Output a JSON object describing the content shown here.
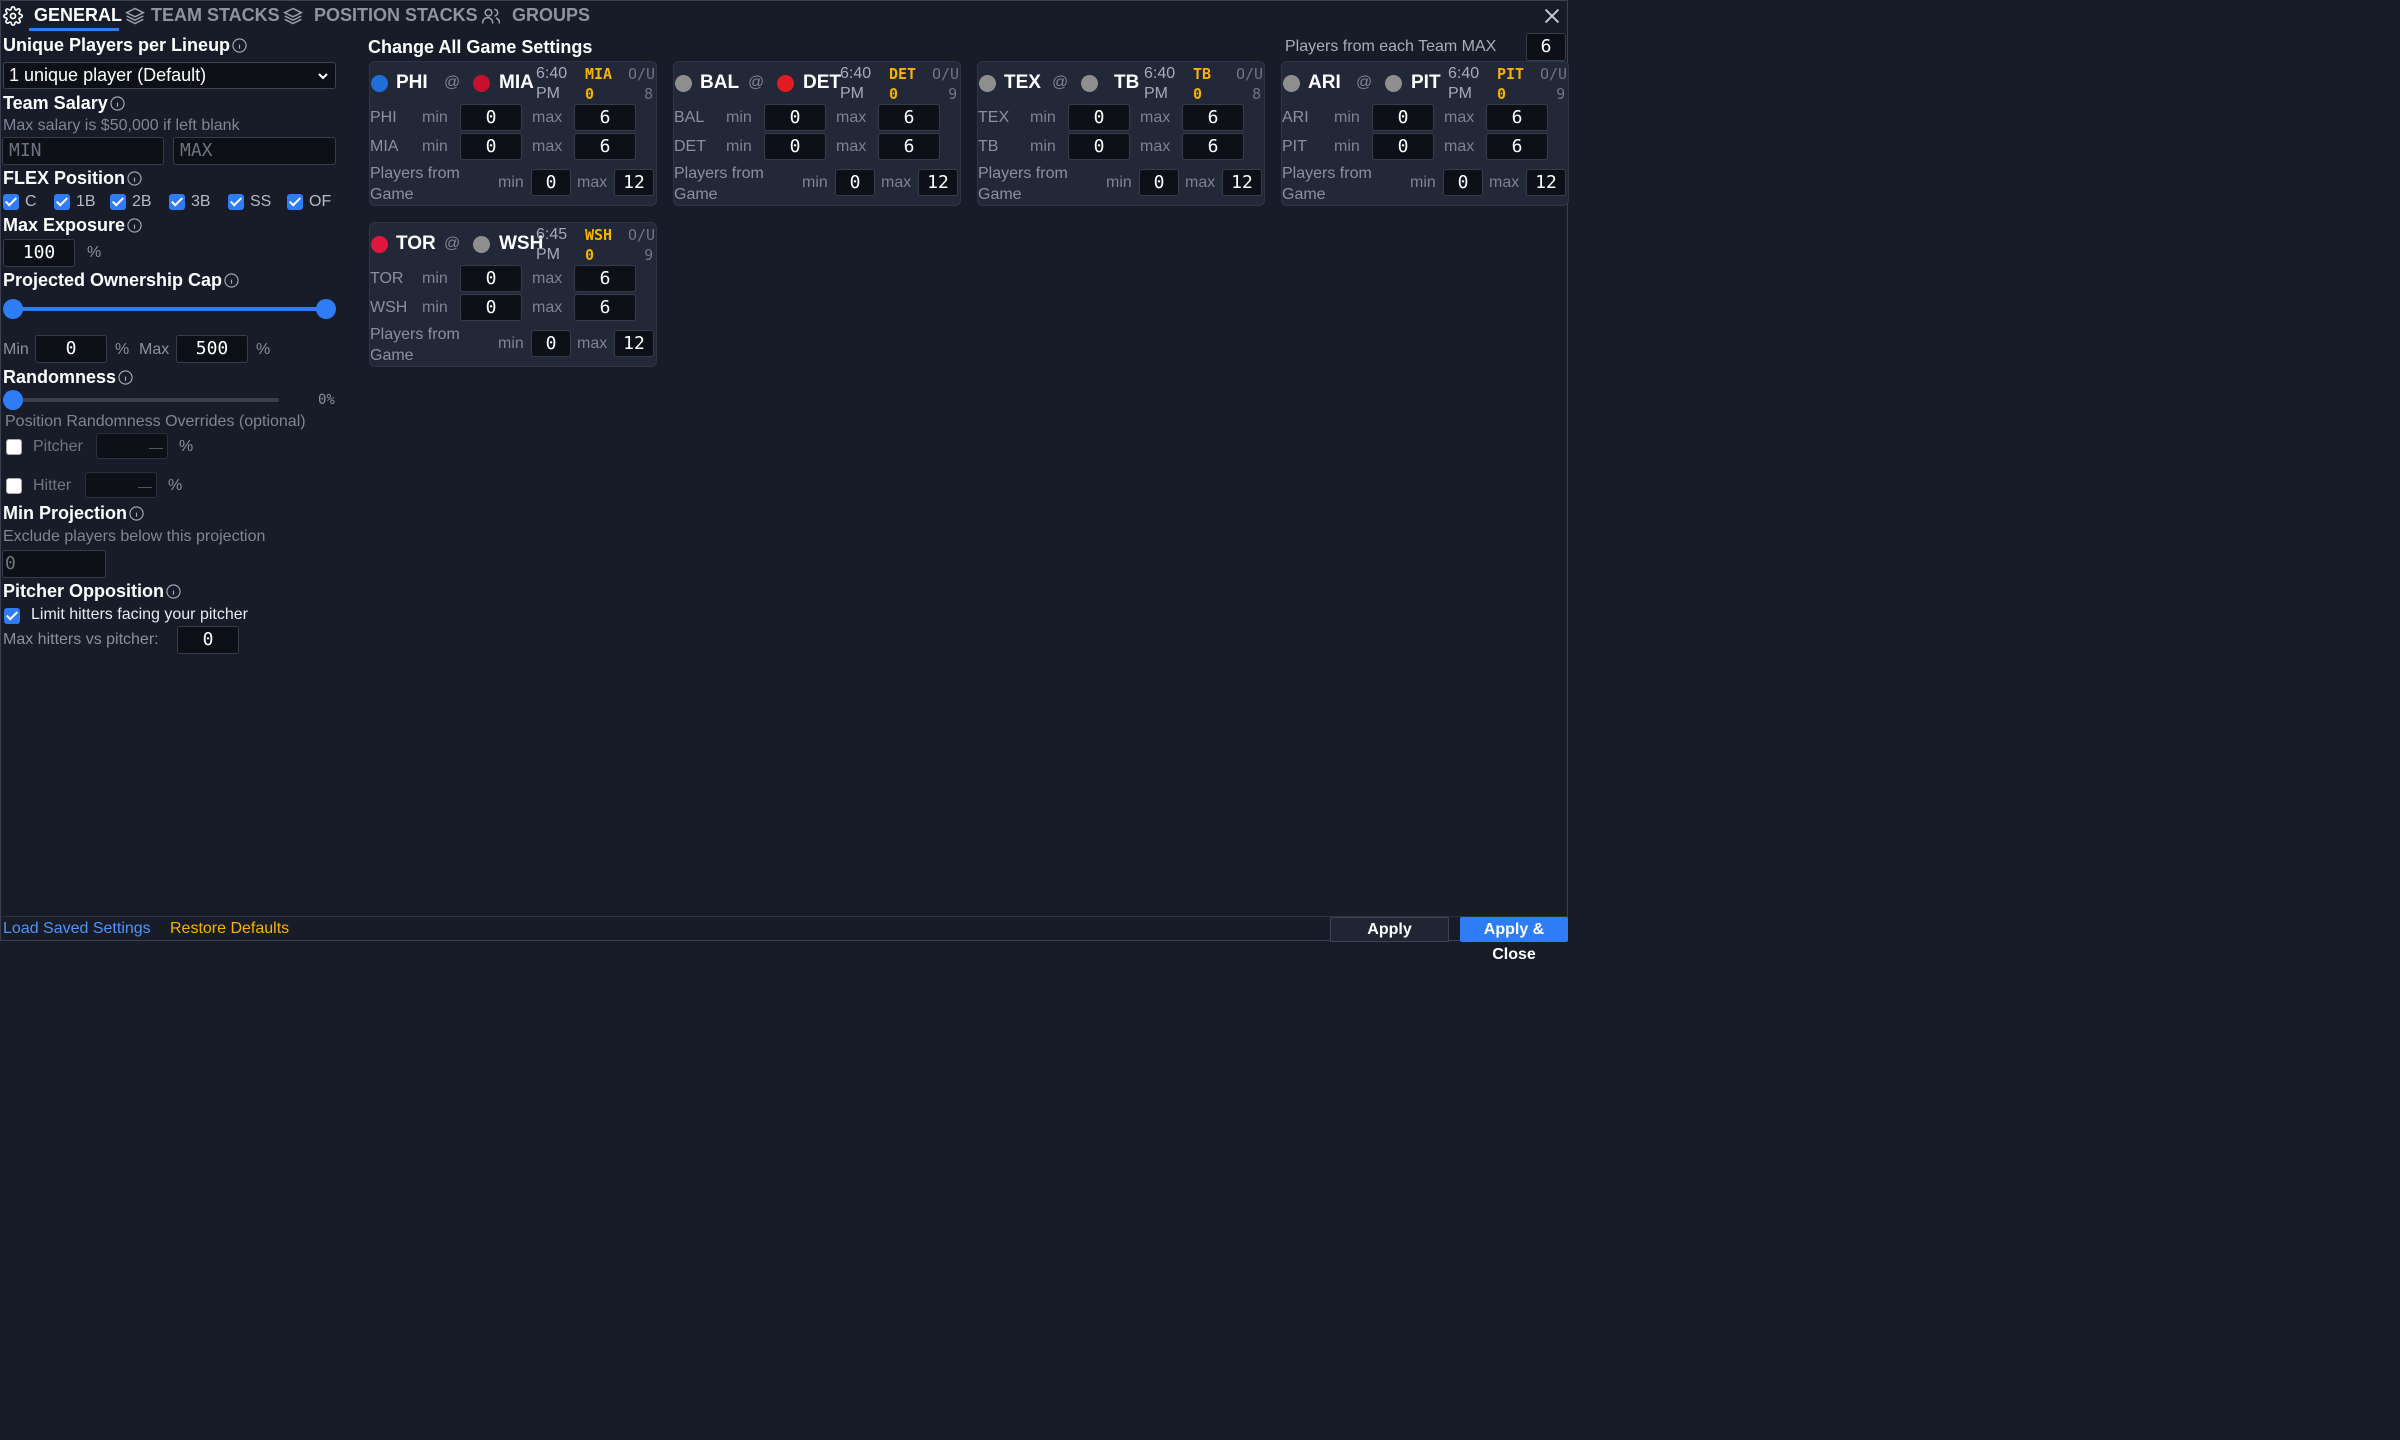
{
  "tabs": [
    {
      "label": "GENERAL"
    },
    {
      "label": "TEAM STACKS"
    },
    {
      "label": "POSITION STACKS"
    },
    {
      "label": "GROUPS"
    }
  ],
  "general": {
    "unique_players": {
      "title": "Unique Players per Lineup",
      "selected": "1 unique player (Default)"
    },
    "team_salary": {
      "title": "Team Salary",
      "hint": "Max salary is $50,000 if left blank",
      "min_placeholder": "MIN",
      "max_placeholder": "MAX"
    },
    "flex_position": {
      "title": "FLEX Position",
      "options": [
        "C",
        "1B",
        "2B",
        "3B",
        "SS",
        "OF"
      ]
    },
    "max_exposure": {
      "title": "Max Exposure",
      "value": "100",
      "unit": "%"
    },
    "ownership_cap": {
      "title": "Projected Ownership Cap",
      "min_label": "Min",
      "min_value": "0",
      "max_label": "Max",
      "max_value": "500",
      "unit": "%"
    },
    "randomness": {
      "title": "Randomness",
      "value_label": "0%",
      "overrides_hint": "Position Randomness Overrides (optional)",
      "pitcher_label": "Pitcher",
      "hitter_label": "Hitter",
      "unit": "%",
      "dash": "—"
    },
    "min_projection": {
      "title": "Min Projection",
      "hint": "Exclude players below this projection",
      "placeholder": "0"
    },
    "pitcher_opposition": {
      "title": "Pitcher Opposition",
      "limit_label": "Limit hitters facing your pitcher",
      "max_label": "Max hitters vs pitcher:",
      "max_value": "0"
    }
  },
  "games_panel": {
    "title": "Change All Game Settings",
    "team_max_label": "Players from each Team MAX",
    "team_max_value": "6",
    "labels": {
      "at": "@",
      "min": "min",
      "max": "max",
      "players_from_game": "Players from Game",
      "ou": "O/U"
    },
    "games": [
      {
        "away": "PHI",
        "home": "MIA",
        "away_color": "#1e6fd9",
        "home_color": "#c8102e",
        "time": "6:40",
        "ampm": "PM",
        "fav": "MIA",
        "fav_val": "0",
        "ou": "8",
        "away_min": "0",
        "away_max": "6",
        "home_min": "0",
        "home_max": "6",
        "game_min": "0",
        "game_max": "12"
      },
      {
        "away": "BAL",
        "home": "DET",
        "away_color": "#8e8e8e",
        "home_color": "#e31b23",
        "time": "6:40",
        "ampm": "PM",
        "fav": "DET",
        "fav_val": "0",
        "ou": "9",
        "away_min": "0",
        "away_max": "6",
        "home_min": "0",
        "home_max": "6",
        "game_min": "0",
        "game_max": "12"
      },
      {
        "away": "TEX",
        "home": "TB",
        "away_color": "#8e8e8e",
        "home_color": "#8e8e8e",
        "time": "6:40",
        "ampm": "PM",
        "fav": "TB",
        "fav_val": "0",
        "ou": "8",
        "away_min": "0",
        "away_max": "6",
        "home_min": "0",
        "home_max": "6",
        "game_min": "0",
        "game_max": "12"
      },
      {
        "away": "ARI",
        "home": "PIT",
        "away_color": "#8e8e8e",
        "home_color": "#8e8e8e",
        "time": "6:40",
        "ampm": "PM",
        "fav": "PIT",
        "fav_val": "0",
        "ou": "9",
        "away_min": "0",
        "away_max": "6",
        "home_min": "0",
        "home_max": "6",
        "game_min": "0",
        "game_max": "12"
      },
      {
        "away": "TOR",
        "home": "WSH",
        "away_color": "#e0163e",
        "home_color": "#8e8e8e",
        "time": "6:45",
        "ampm": "PM",
        "fav": "WSH",
        "fav_val": "0",
        "ou": "9",
        "away_min": "0",
        "away_max": "6",
        "home_min": "0",
        "home_max": "6",
        "game_min": "0",
        "game_max": "12"
      }
    ]
  },
  "footer": {
    "load": "Load Saved Settings",
    "restore": "Restore Defaults",
    "apply": "Apply",
    "apply_close": "Apply & Close"
  },
  "colors": {
    "accent": "#2f7df6",
    "warning": "#f5b301",
    "background": "#171c28"
  }
}
